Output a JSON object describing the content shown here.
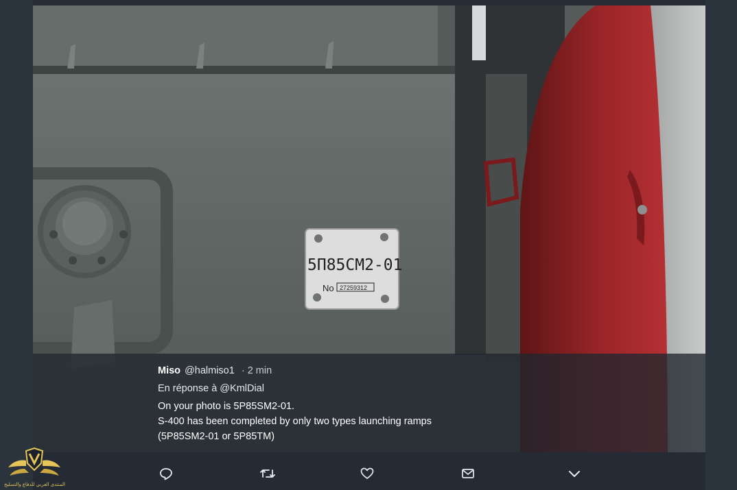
{
  "tweet": {
    "name": "Miso",
    "handle": "@halmiso1",
    "time": "· 2 min",
    "reply_prefix": "En réponse à",
    "reply_to": "@KmlDial",
    "lines": [
      "On your photo is 5P85SM2-01.",
      "S-400 has been completed by only two types launching ramps",
      "(5P85SM2-01 or 5P85TM)"
    ]
  },
  "photo": {
    "plate_model": "5П85СМ2-01",
    "plate_no_label": "No",
    "plate_serial": "27259312"
  },
  "actions": {
    "reply": "reply-icon",
    "retweet": "retweet-icon",
    "like": "heart-icon",
    "message": "envelope-icon",
    "more": "chevron-down-icon"
  },
  "watermark": {
    "text": "المنتدى العربي للدفاع والتسليح"
  },
  "colors": {
    "metal": "#5d6361",
    "red": "#a3282a",
    "overlay": "#20262e",
    "frame": "#2b333d"
  }
}
